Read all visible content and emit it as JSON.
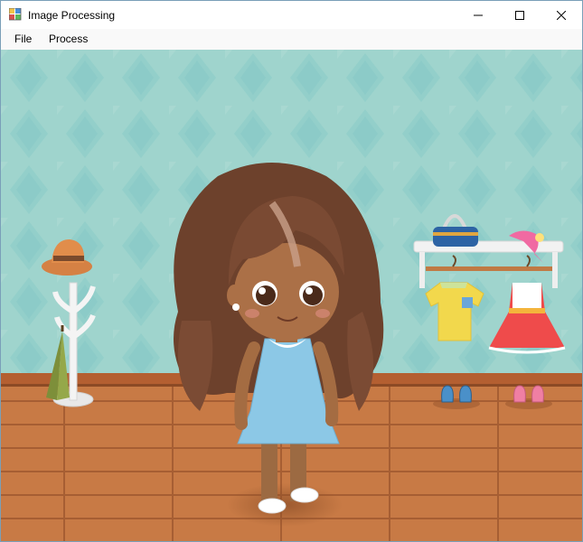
{
  "window": {
    "title": "Image Processing",
    "controls": {
      "minimize": "minimize-icon",
      "maximize": "maximize-icon",
      "close": "close-icon"
    }
  },
  "menu": {
    "items": [
      {
        "label": "File"
      },
      {
        "label": "Process"
      }
    ]
  },
  "canvas": {
    "description_icon": "image-canvas",
    "colors": {
      "wall": "#9ed3cd",
      "wall_diamond": "#8ecfcb",
      "floor": "#c97a45",
      "floor_line": "#a85f35",
      "baseboard": "#b25d2f",
      "hair": "#6f4330",
      "skin": "#a86e43",
      "dress": "#8ec8e6"
    }
  }
}
